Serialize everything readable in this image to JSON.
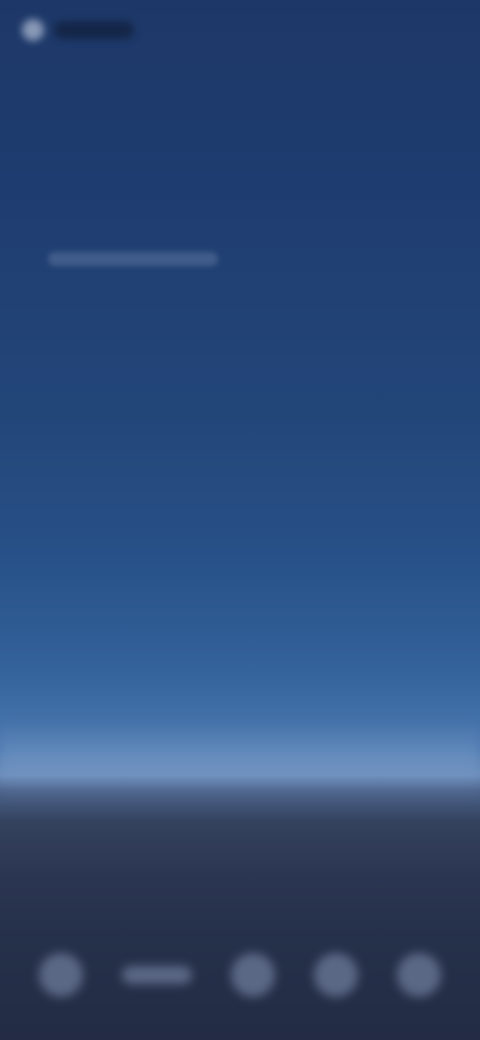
{
  "screen": {
    "state": "blurred-wallpaper",
    "colors": {
      "sky_top": "#1d3868",
      "sky_mid": "#28528a",
      "horizon": "#6a8cbb",
      "ground": "#232c44"
    }
  },
  "status_bar": {
    "icons": [
      "status-indicator-icon"
    ]
  },
  "dock": {
    "icons": [
      "dock-app-icon-1",
      "dock-app-icon-2",
      "dock-app-icon-3",
      "dock-app-icon-4",
      "dock-app-icon-5"
    ]
  }
}
